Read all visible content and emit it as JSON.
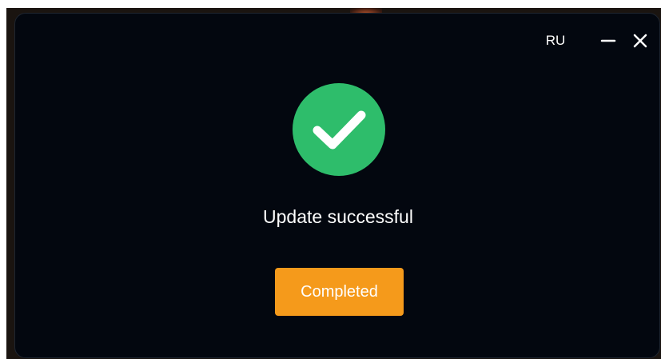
{
  "window": {
    "language_label": "RU",
    "controls": {
      "minimize_icon": "minimize-icon",
      "close_icon": "close-icon"
    }
  },
  "main": {
    "status_icon": "check-circle-icon",
    "status_text": "Update successful",
    "action_button_label": "Completed"
  },
  "colors": {
    "dialog_background": "#03070f",
    "success_green": "#2ebd6b",
    "button_orange": "#f59a1b",
    "text": "#ffffff"
  }
}
